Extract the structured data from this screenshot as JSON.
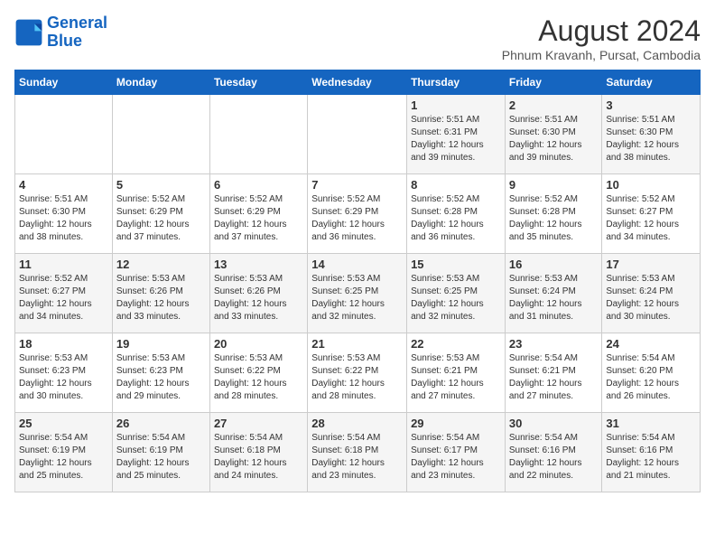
{
  "header": {
    "logo_line1": "General",
    "logo_line2": "Blue",
    "month_year": "August 2024",
    "location": "Phnum Kravanh, Pursat, Cambodia"
  },
  "days_of_week": [
    "Sunday",
    "Monday",
    "Tuesday",
    "Wednesday",
    "Thursday",
    "Friday",
    "Saturday"
  ],
  "weeks": [
    [
      {
        "day": "",
        "info": ""
      },
      {
        "day": "",
        "info": ""
      },
      {
        "day": "",
        "info": ""
      },
      {
        "day": "",
        "info": ""
      },
      {
        "day": "1",
        "info": "Sunrise: 5:51 AM\nSunset: 6:31 PM\nDaylight: 12 hours\nand 39 minutes."
      },
      {
        "day": "2",
        "info": "Sunrise: 5:51 AM\nSunset: 6:30 PM\nDaylight: 12 hours\nand 39 minutes."
      },
      {
        "day": "3",
        "info": "Sunrise: 5:51 AM\nSunset: 6:30 PM\nDaylight: 12 hours\nand 38 minutes."
      }
    ],
    [
      {
        "day": "4",
        "info": "Sunrise: 5:51 AM\nSunset: 6:30 PM\nDaylight: 12 hours\nand 38 minutes."
      },
      {
        "day": "5",
        "info": "Sunrise: 5:52 AM\nSunset: 6:29 PM\nDaylight: 12 hours\nand 37 minutes."
      },
      {
        "day": "6",
        "info": "Sunrise: 5:52 AM\nSunset: 6:29 PM\nDaylight: 12 hours\nand 37 minutes."
      },
      {
        "day": "7",
        "info": "Sunrise: 5:52 AM\nSunset: 6:29 PM\nDaylight: 12 hours\nand 36 minutes."
      },
      {
        "day": "8",
        "info": "Sunrise: 5:52 AM\nSunset: 6:28 PM\nDaylight: 12 hours\nand 36 minutes."
      },
      {
        "day": "9",
        "info": "Sunrise: 5:52 AM\nSunset: 6:28 PM\nDaylight: 12 hours\nand 35 minutes."
      },
      {
        "day": "10",
        "info": "Sunrise: 5:52 AM\nSunset: 6:27 PM\nDaylight: 12 hours\nand 34 minutes."
      }
    ],
    [
      {
        "day": "11",
        "info": "Sunrise: 5:52 AM\nSunset: 6:27 PM\nDaylight: 12 hours\nand 34 minutes."
      },
      {
        "day": "12",
        "info": "Sunrise: 5:53 AM\nSunset: 6:26 PM\nDaylight: 12 hours\nand 33 minutes."
      },
      {
        "day": "13",
        "info": "Sunrise: 5:53 AM\nSunset: 6:26 PM\nDaylight: 12 hours\nand 33 minutes."
      },
      {
        "day": "14",
        "info": "Sunrise: 5:53 AM\nSunset: 6:25 PM\nDaylight: 12 hours\nand 32 minutes."
      },
      {
        "day": "15",
        "info": "Sunrise: 5:53 AM\nSunset: 6:25 PM\nDaylight: 12 hours\nand 32 minutes."
      },
      {
        "day": "16",
        "info": "Sunrise: 5:53 AM\nSunset: 6:24 PM\nDaylight: 12 hours\nand 31 minutes."
      },
      {
        "day": "17",
        "info": "Sunrise: 5:53 AM\nSunset: 6:24 PM\nDaylight: 12 hours\nand 30 minutes."
      }
    ],
    [
      {
        "day": "18",
        "info": "Sunrise: 5:53 AM\nSunset: 6:23 PM\nDaylight: 12 hours\nand 30 minutes."
      },
      {
        "day": "19",
        "info": "Sunrise: 5:53 AM\nSunset: 6:23 PM\nDaylight: 12 hours\nand 29 minutes."
      },
      {
        "day": "20",
        "info": "Sunrise: 5:53 AM\nSunset: 6:22 PM\nDaylight: 12 hours\nand 28 minutes."
      },
      {
        "day": "21",
        "info": "Sunrise: 5:53 AM\nSunset: 6:22 PM\nDaylight: 12 hours\nand 28 minutes."
      },
      {
        "day": "22",
        "info": "Sunrise: 5:53 AM\nSunset: 6:21 PM\nDaylight: 12 hours\nand 27 minutes."
      },
      {
        "day": "23",
        "info": "Sunrise: 5:54 AM\nSunset: 6:21 PM\nDaylight: 12 hours\nand 27 minutes."
      },
      {
        "day": "24",
        "info": "Sunrise: 5:54 AM\nSunset: 6:20 PM\nDaylight: 12 hours\nand 26 minutes."
      }
    ],
    [
      {
        "day": "25",
        "info": "Sunrise: 5:54 AM\nSunset: 6:19 PM\nDaylight: 12 hours\nand 25 minutes."
      },
      {
        "day": "26",
        "info": "Sunrise: 5:54 AM\nSunset: 6:19 PM\nDaylight: 12 hours\nand 25 minutes."
      },
      {
        "day": "27",
        "info": "Sunrise: 5:54 AM\nSunset: 6:18 PM\nDaylight: 12 hours\nand 24 minutes."
      },
      {
        "day": "28",
        "info": "Sunrise: 5:54 AM\nSunset: 6:18 PM\nDaylight: 12 hours\nand 23 minutes."
      },
      {
        "day": "29",
        "info": "Sunrise: 5:54 AM\nSunset: 6:17 PM\nDaylight: 12 hours\nand 23 minutes."
      },
      {
        "day": "30",
        "info": "Sunrise: 5:54 AM\nSunset: 6:16 PM\nDaylight: 12 hours\nand 22 minutes."
      },
      {
        "day": "31",
        "info": "Sunrise: 5:54 AM\nSunset: 6:16 PM\nDaylight: 12 hours\nand 21 minutes."
      }
    ]
  ]
}
